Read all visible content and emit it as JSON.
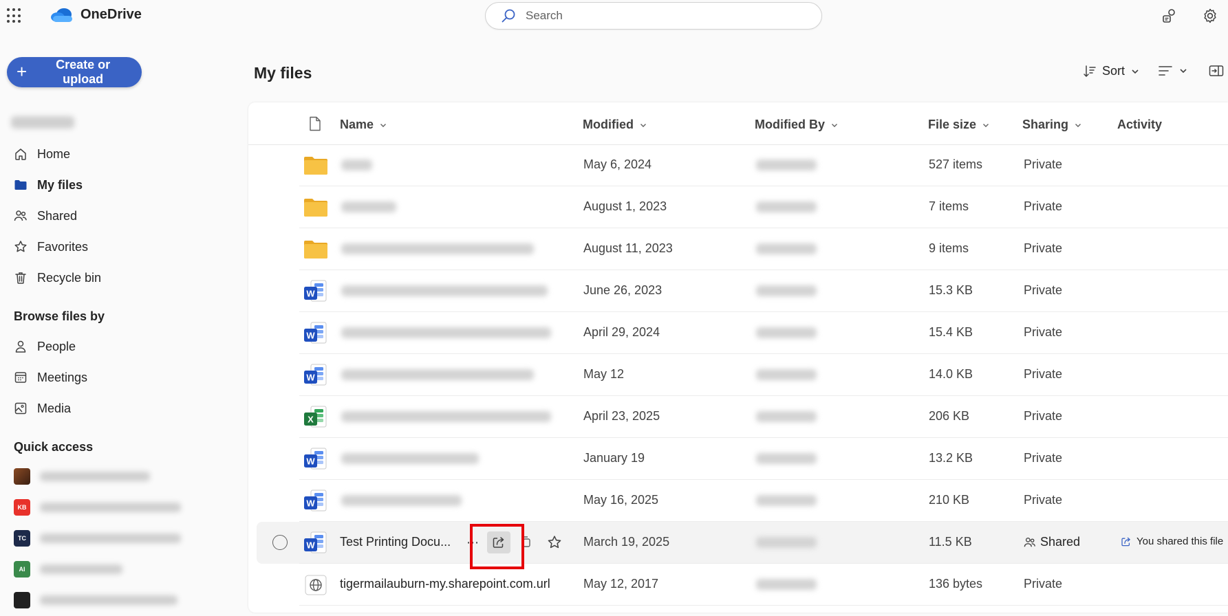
{
  "app": {
    "name": "OneDrive"
  },
  "search": {
    "placeholder": "Search"
  },
  "sidebar": {
    "create_label": "Create or upload",
    "nav": [
      {
        "label": "Home",
        "icon": "home-icon"
      },
      {
        "label": "My files",
        "icon": "folder-icon",
        "active": true
      },
      {
        "label": "Shared",
        "icon": "people-icon"
      },
      {
        "label": "Favorites",
        "icon": "star-icon"
      },
      {
        "label": "Recycle bin",
        "icon": "trash-icon"
      }
    ],
    "browse_heading": "Browse files by",
    "browse": [
      {
        "label": "People",
        "icon": "person-icon"
      },
      {
        "label": "Meetings",
        "icon": "calendar-icon"
      },
      {
        "label": "Media",
        "icon": "image-icon"
      }
    ],
    "quick_access_heading": "Quick access",
    "quick_access": [
      {
        "tile_text": "",
        "color": "#6b3a1f"
      },
      {
        "tile_text": "KB",
        "color": "#e8322b"
      },
      {
        "tile_text": "TC",
        "color": "#1d2a4a"
      },
      {
        "tile_text": "AI",
        "color": "#3a8a4b"
      },
      {
        "tile_text": "",
        "color": "#202020"
      }
    ]
  },
  "main": {
    "title": "My files",
    "sort_label": "Sort"
  },
  "table": {
    "columns": {
      "name": "Name",
      "modified": "Modified",
      "modified_by": "Modified By",
      "file_size": "File size",
      "sharing": "Sharing",
      "activity": "Activity"
    },
    "rows": [
      {
        "type": "folder",
        "name": "",
        "modified": "May 6, 2024",
        "size": "527 items",
        "sharing": "Private"
      },
      {
        "type": "folder",
        "name": "",
        "modified": "August 1, 2023",
        "size": "7 items",
        "sharing": "Private"
      },
      {
        "type": "folder",
        "name": "",
        "modified": "August 11, 2023",
        "size": "9 items",
        "sharing": "Private"
      },
      {
        "type": "word",
        "name": "",
        "modified": "June 26, 2023",
        "size": "15.3 KB",
        "sharing": "Private"
      },
      {
        "type": "word",
        "name": "",
        "modified": "April 29, 2024",
        "size": "15.4 KB",
        "sharing": "Private"
      },
      {
        "type": "word",
        "name": "",
        "modified": "May 12",
        "size": "14.0 KB",
        "sharing": "Private"
      },
      {
        "type": "excel",
        "name": "",
        "modified": "April 23, 2025",
        "size": "206 KB",
        "sharing": "Private"
      },
      {
        "type": "word",
        "name": "",
        "modified": "January 19",
        "size": "13.2 KB",
        "sharing": "Private"
      },
      {
        "type": "word",
        "name": "",
        "modified": "May 16, 2025",
        "size": "210 KB",
        "sharing": "Private"
      },
      {
        "type": "word",
        "name": "Test Printing Docu...",
        "modified": "March 19, 2025",
        "size": "11.5 KB",
        "sharing": "Shared",
        "activity": "You shared this file",
        "selected": true
      },
      {
        "type": "link",
        "name": "tigermailauburn-my.sharepoint.com.url",
        "modified": "May 12, 2017",
        "size": "136 bytes",
        "sharing": "Private"
      }
    ]
  },
  "colors": {
    "accent": "#3a63c5",
    "highlight": "#e6000a",
    "folder": "#f7c244",
    "word": "#2b5fd9",
    "excel": "#1f7a3d"
  }
}
